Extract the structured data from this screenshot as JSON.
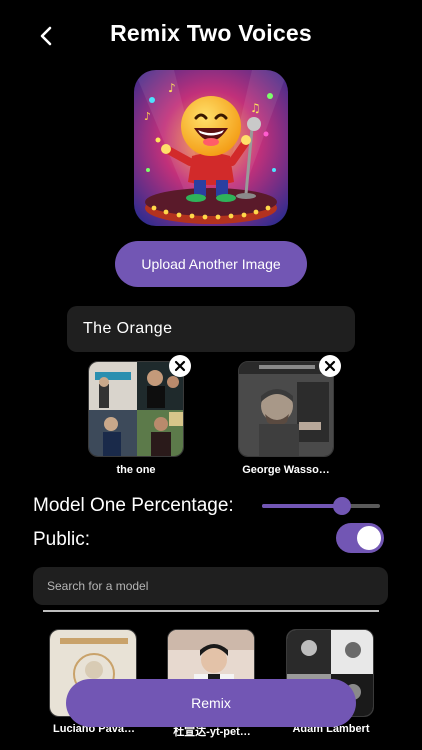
{
  "header": {
    "title": "Remix Two Voices",
    "back_icon": "chevron-left-icon"
  },
  "hero": {
    "image": "singing-emoji-character-illustration"
  },
  "upload_button": {
    "label": "Upload Another Image"
  },
  "name_field": {
    "value": "The Orange"
  },
  "selected_voices": [
    {
      "label": "the one",
      "image": "album-collage"
    },
    {
      "label": "George Wasso…",
      "image": "man-portrait-photo"
    }
  ],
  "model_percentage": {
    "label": "Model One Percentage:",
    "value_fraction": 0.68
  },
  "public_toggle": {
    "label": "Public:",
    "on": true
  },
  "search": {
    "placeholder": "Search for a model"
  },
  "models": [
    {
      "label": "Luciano Pava…",
      "image": "pavarotti-album-cover"
    },
    {
      "label": "杜宣达-yt-pet…",
      "image": "singer-portrait"
    },
    {
      "label": "Adam Lambert",
      "image": "adam-lambert-collage"
    }
  ],
  "remix_button": {
    "label": "Remix"
  },
  "colors": {
    "accent": "#7256b4",
    "background": "#000000",
    "field": "#1f1f1f"
  }
}
